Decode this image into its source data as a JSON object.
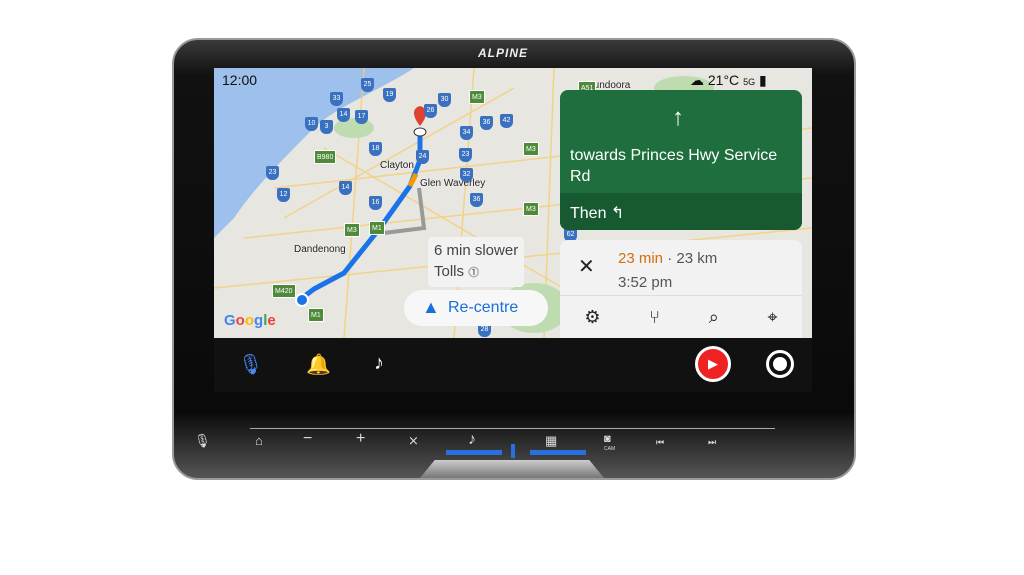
{
  "device": {
    "brand": "ALPINE"
  },
  "status": {
    "time": "12:00",
    "weather_icon": "cloud-icon",
    "temperature": "21°C",
    "network": "5G"
  },
  "map": {
    "places": [
      "Bundoora",
      "Clayton",
      "Glen Waverley",
      "Dandenong"
    ],
    "shields_blue": [
      "33",
      "25",
      "19",
      "30",
      "26",
      "14",
      "17",
      "10",
      "3",
      "36",
      "42",
      "34",
      "18",
      "24",
      "23",
      "32",
      "23",
      "14",
      "12",
      "16",
      "36",
      "62",
      "28"
    ],
    "shields_green": [
      "M3",
      "A51",
      "B980",
      "M3",
      "M3",
      "M3",
      "M1",
      "M420",
      "M1"
    ],
    "logo": "Google",
    "route_color": "#1a73e8"
  },
  "navigation": {
    "direction_icon": "arrow-up-icon",
    "street": "towards Princes Hwy Service Rd",
    "then_label": "Then",
    "then_icon": "turn-left-icon"
  },
  "trip": {
    "duration": "23 min",
    "separator": "·",
    "distance": "23 km",
    "arrival": "3:52 pm",
    "actions": [
      "settings",
      "route-options",
      "search",
      "location"
    ]
  },
  "alternate": {
    "line1": "6 min slower",
    "line2": "Tolls"
  },
  "recentre": {
    "label": "Re-centre"
  },
  "dock": {
    "items": [
      "microphone",
      "notifications",
      "music",
      "youtube-music",
      "record"
    ]
  },
  "hardware_buttons": [
    "map",
    "volume-down",
    "volume-up",
    "mute",
    "audio",
    "apps",
    "camera",
    "previous",
    "next"
  ],
  "hardware_labels": {
    "cam": "CAM"
  }
}
